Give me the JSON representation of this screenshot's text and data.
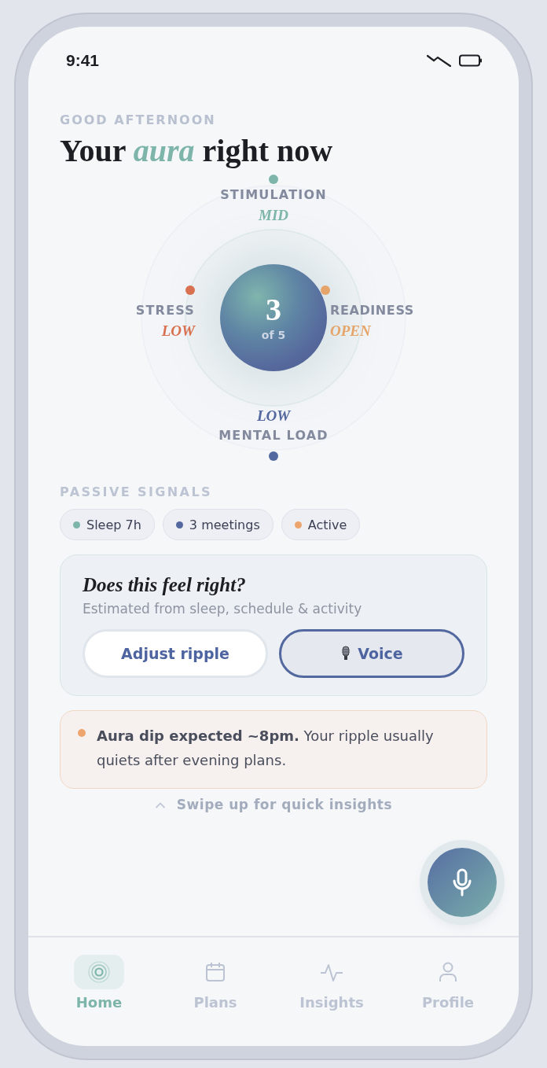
{
  "status_bar": {
    "time": "9:41"
  },
  "greeting": "GOOD AFTERNOON",
  "title": "Your *aura* right now",
  "dial": {
    "score": "3",
    "score_caption": "of 5",
    "axes": [
      {
        "kind": "top",
        "label": "STIMULATION",
        "value": "MID",
        "color": "#7db5aa"
      },
      {
        "kind": "left",
        "label": "STRESS",
        "value": "LOW",
        "color": "#d9704f"
      },
      {
        "kind": "right",
        "label": "READINESS",
        "value": "OPEN",
        "color": "#e5a56a"
      },
      {
        "kind": "bottom",
        "label": "MENTAL LOAD",
        "value": "LOW",
        "color": "#53689f"
      }
    ]
  },
  "signals": {
    "heading": "PASSIVE SIGNALS",
    "items": [
      {
        "label": "Sleep 7h",
        "color": "#7db5aa"
      },
      {
        "label": "3 meetings",
        "color": "#53689f"
      },
      {
        "label": "Active",
        "color": "#eda56d"
      }
    ]
  },
  "check_card": {
    "title": "Does this feel right?",
    "subtitle": "Estimated from sleep, schedule & activity",
    "buttons": [
      {
        "kind": "plain",
        "label": "Adjust ripple"
      },
      {
        "kind": "voice",
        "label": "Voice"
      }
    ]
  },
  "alert": {
    "text": "**Aura dip expected ~8pm.** Your ripple usually quiets after evening plans."
  },
  "hint": "Swipe up for quick insights",
  "tabs": [
    {
      "label": "Home",
      "selected": true
    },
    {
      "label": "Plans",
      "selected": false
    },
    {
      "label": "Insights",
      "selected": false
    },
    {
      "label": "Profile",
      "selected": false
    }
  ]
}
